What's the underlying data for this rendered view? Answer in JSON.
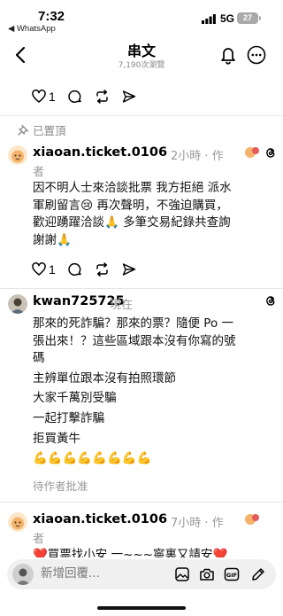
{
  "status_bar": {
    "time": "7:32",
    "back_app": "◀ WhatsApp",
    "network": "5G",
    "battery": "27"
  },
  "header": {
    "title": "串文",
    "views": "7,190次瀏覽"
  },
  "top_actions": {
    "like_count": "1"
  },
  "pinned_label": "已置頂",
  "posts": [
    {
      "username": "xiaoan.ticket.0106",
      "time": "2小時",
      "author_sep": "·",
      "author_label": "作",
      "author_label_2": "者",
      "lines": [
        "因不明人士來洽談批票 我方拒絕 派水",
        "軍刷留言😢 再次聲明，不強迫購買，",
        "歡迎踴躍洽談🙏 多筆交易紀錄共查詢",
        "謝謝🙏"
      ],
      "like_count": "1"
    },
    {
      "username": "kwan725725",
      "time": "現在",
      "lines": [
        "那來的死詐騙？那來的票？隨便 Po 一",
        "張出來！？這些區域跟本沒有你寫的號",
        "碼",
        "主辨單位跟本沒有拍照環節",
        "大家千萬別受騙",
        "一起打擊詐騙",
        "拒買黃牛",
        "💪💪💪💪💪💪💪💪"
      ],
      "pending": "待作者批准"
    },
    {
      "username": "xiaoan.ticket.0106",
      "time": "7小時",
      "author_sep": "·",
      "author_label": "作",
      "author_label_2": "者",
      "partial_line": "❤️買票找小安 一~~~寧裏又請安❤️"
    }
  ],
  "reply_bar": {
    "placeholder": "新增回覆..."
  },
  "colors": {
    "muted": "#999999",
    "divider": "#e6e6e6",
    "reply_bg": "#f0f0f0"
  },
  "icons": [
    "back-chevron-icon",
    "bell-icon",
    "more-icon",
    "heart-icon",
    "comment-icon",
    "repost-icon",
    "share-icon",
    "pin-icon",
    "threads-icon",
    "gallery-icon",
    "camera-icon",
    "gif-icon",
    "edit-icon"
  ]
}
